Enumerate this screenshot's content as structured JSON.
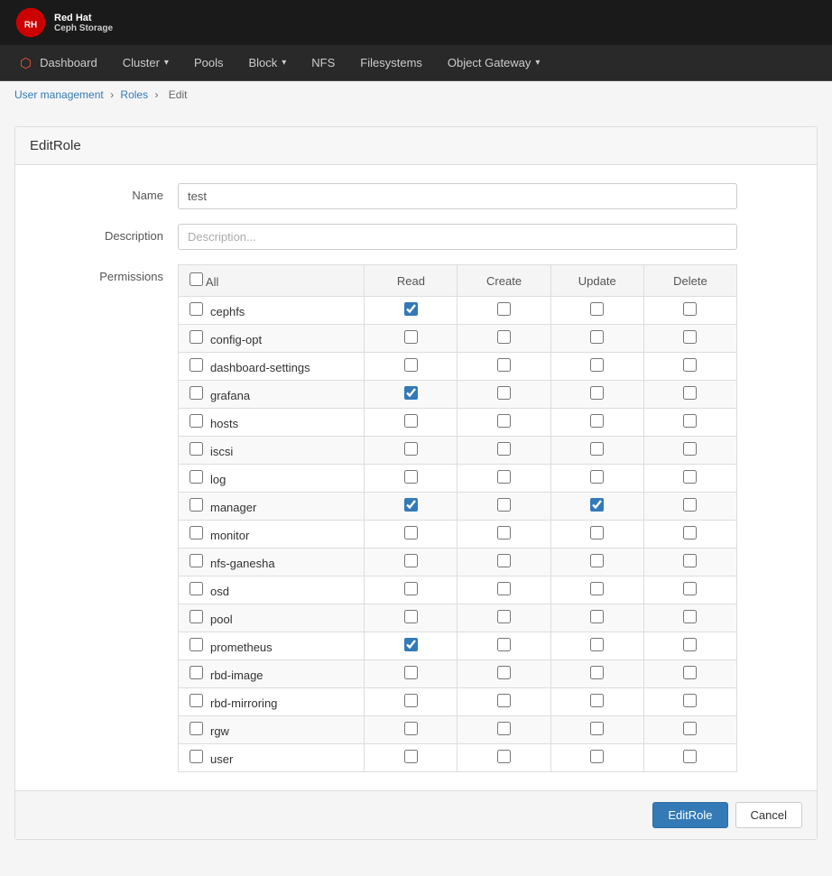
{
  "brand": {
    "name": "Red Hat\nCeph Storage"
  },
  "navbar": {
    "items": [
      {
        "id": "dashboard",
        "label": "Dashboard",
        "has_icon": true,
        "has_dropdown": false
      },
      {
        "id": "cluster",
        "label": "Cluster",
        "has_dropdown": true
      },
      {
        "id": "pools",
        "label": "Pools",
        "has_dropdown": false
      },
      {
        "id": "block",
        "label": "Block",
        "has_dropdown": true
      },
      {
        "id": "nfs",
        "label": "NFS",
        "has_dropdown": false
      },
      {
        "id": "filesystems",
        "label": "Filesystems",
        "has_dropdown": false
      },
      {
        "id": "object_gateway",
        "label": "Object Gateway",
        "has_dropdown": true
      }
    ]
  },
  "breadcrumb": {
    "items": [
      {
        "label": "User management",
        "link": true
      },
      {
        "label": "Roles",
        "link": true
      },
      {
        "label": "Edit",
        "link": false
      }
    ]
  },
  "page": {
    "title": "EditRole",
    "name_label": "Name",
    "name_value": "test",
    "name_placeholder": "",
    "description_label": "Description",
    "description_placeholder": "Description...",
    "permissions_label": "Permissions"
  },
  "table": {
    "headers": [
      {
        "id": "resource",
        "label": "All"
      },
      {
        "id": "read",
        "label": "Read"
      },
      {
        "id": "create",
        "label": "Create"
      },
      {
        "id": "update",
        "label": "Update"
      },
      {
        "id": "delete",
        "label": "Delete"
      }
    ],
    "rows": [
      {
        "name": "cephfs",
        "all": false,
        "read": true,
        "create": false,
        "update": false,
        "delete": false
      },
      {
        "name": "config-opt",
        "all": false,
        "read": false,
        "create": false,
        "update": false,
        "delete": false
      },
      {
        "name": "dashboard-settings",
        "all": false,
        "read": false,
        "create": false,
        "update": false,
        "delete": false
      },
      {
        "name": "grafana",
        "all": false,
        "read": true,
        "create": false,
        "update": false,
        "delete": false
      },
      {
        "name": "hosts",
        "all": false,
        "read": false,
        "create": false,
        "update": false,
        "delete": false
      },
      {
        "name": "iscsi",
        "all": false,
        "read": false,
        "create": false,
        "update": false,
        "delete": false
      },
      {
        "name": "log",
        "all": false,
        "read": false,
        "create": false,
        "update": false,
        "delete": false
      },
      {
        "name": "manager",
        "all": false,
        "read": true,
        "create": false,
        "update": true,
        "delete": false
      },
      {
        "name": "monitor",
        "all": false,
        "read": false,
        "create": false,
        "update": false,
        "delete": false
      },
      {
        "name": "nfs-ganesha",
        "all": false,
        "read": false,
        "create": false,
        "update": false,
        "delete": false
      },
      {
        "name": "osd",
        "all": false,
        "read": false,
        "create": false,
        "update": false,
        "delete": false
      },
      {
        "name": "pool",
        "all": false,
        "read": false,
        "create": false,
        "update": false,
        "delete": false
      },
      {
        "name": "prometheus",
        "all": false,
        "read": true,
        "create": false,
        "update": false,
        "delete": false
      },
      {
        "name": "rbd-image",
        "all": false,
        "read": false,
        "create": false,
        "update": false,
        "delete": false
      },
      {
        "name": "rbd-mirroring",
        "all": false,
        "read": false,
        "create": false,
        "update": false,
        "delete": false
      },
      {
        "name": "rgw",
        "all": false,
        "read": false,
        "create": false,
        "update": false,
        "delete": false
      },
      {
        "name": "user",
        "all": false,
        "read": false,
        "create": false,
        "update": false,
        "delete": false
      }
    ]
  },
  "footer": {
    "edit_role_button": "EditRole",
    "cancel_button": "Cancel"
  }
}
